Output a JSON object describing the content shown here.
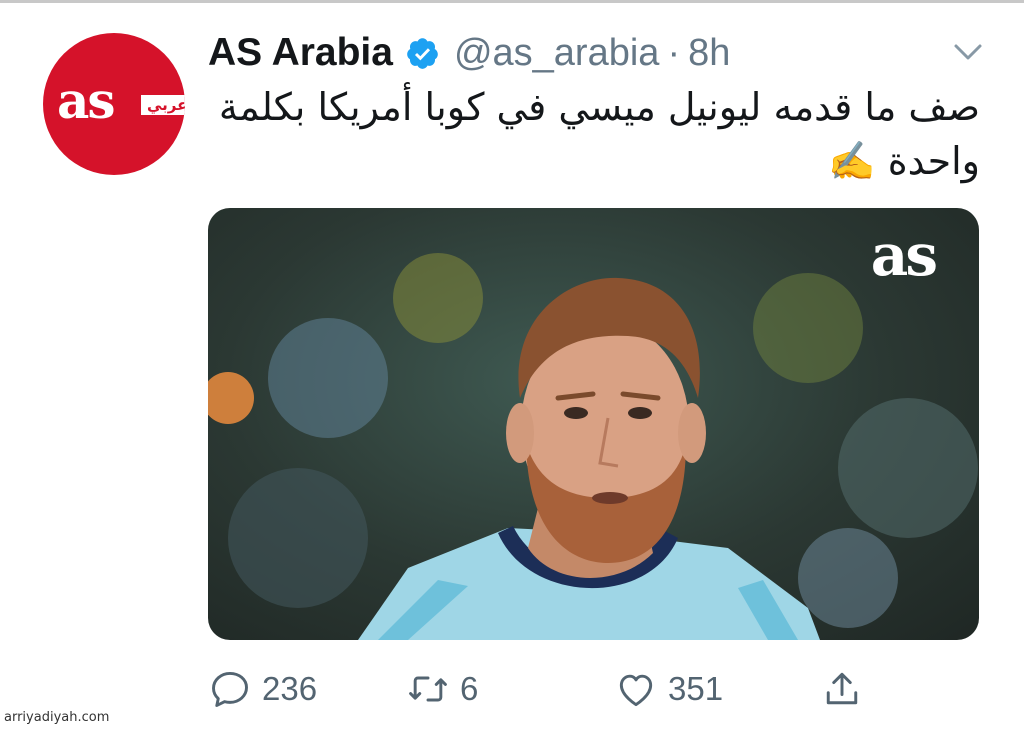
{
  "tweet": {
    "author_name": "AS Arabia",
    "handle": "@as_arabia",
    "separator": "·",
    "time": "8h",
    "text_lines": [
      "صف ما قدمه ليونيل ميسي في كوبا أمريكا بكلمة",
      "واحدة ✍️"
    ]
  },
  "avatar": {
    "logo_text": "as",
    "tag_text": "عربي"
  },
  "media": {
    "watermark": "as"
  },
  "actions": {
    "reply_count": "236",
    "retweet_count": "6",
    "like_count": "351"
  },
  "footer": {
    "credit": "arriyadiyah.com"
  },
  "colors": {
    "brand_red": "#d5122a",
    "verified_blue": "#1da1f2",
    "muted_text": "#657786"
  },
  "icons": [
    "verified-badge-icon",
    "chevron-down-icon",
    "reply-icon",
    "retweet-icon",
    "like-icon",
    "share-icon"
  ]
}
